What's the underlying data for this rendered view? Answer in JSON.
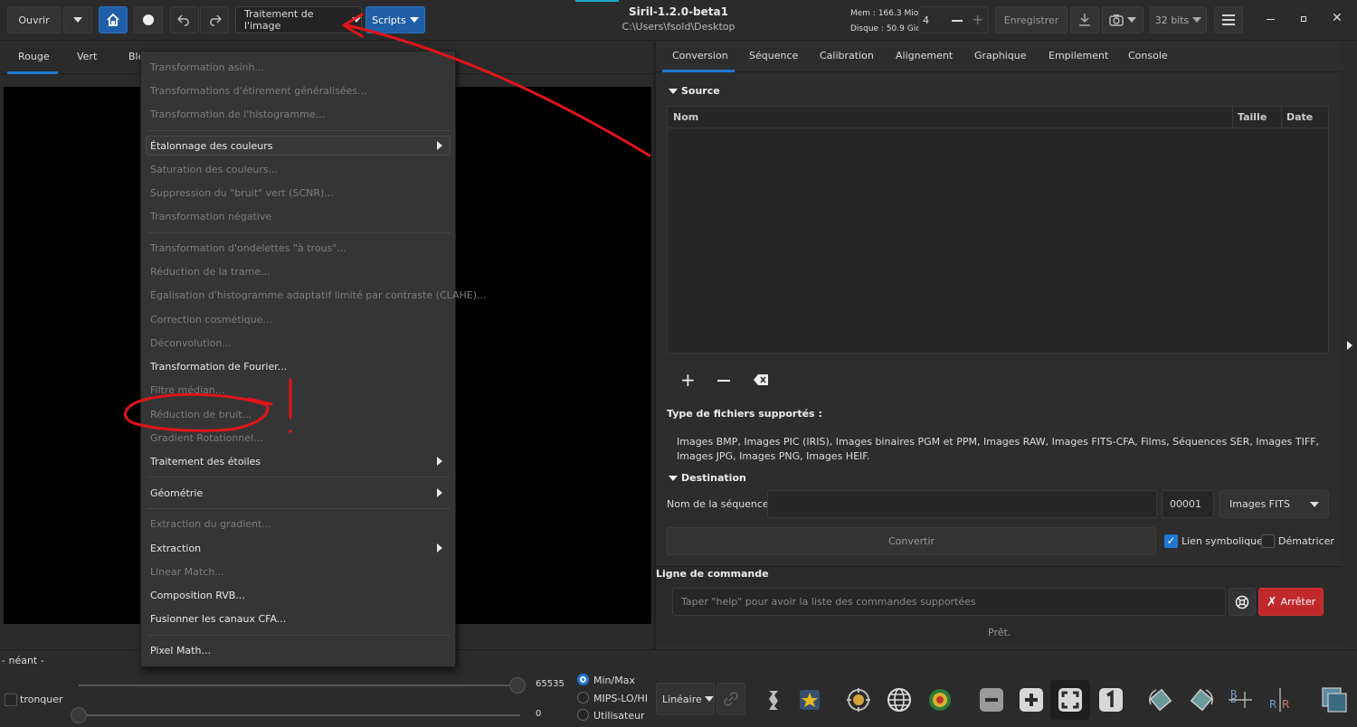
{
  "toolbar": {
    "open_label": "Ouvrir",
    "processing_label": "Traitement de l'image",
    "scripts_label": "Scripts",
    "memory": "Mem : 166.3 Mio",
    "disk": "Disque : 50.9 Gio",
    "threads_value": "4",
    "save_label": "Enregistrer",
    "bitdepth_label": "32 bits"
  },
  "window": {
    "title": "Siril-1.2.0-beta1",
    "path": "C:\\Users\\fsold\\Desktop"
  },
  "left_tabs": [
    "Rouge",
    "Vert",
    "Ble"
  ],
  "right_tabs": [
    "Conversion",
    "Séquence",
    "Calibration",
    "Alignement",
    "Graphique",
    "Empilement",
    "Console"
  ],
  "menu": {
    "items": [
      {
        "label": "Transformation asinh...",
        "enabled": false
      },
      {
        "label": "Transformations d'étirement généralisées...",
        "enabled": false
      },
      {
        "label": "Transformation de l'histogramme...",
        "enabled": false
      },
      {
        "label": "Étalonnage des couleurs",
        "enabled": true
      },
      {
        "label": "Saturation des couleurs...",
        "enabled": false
      },
      {
        "label": "Suppression du \"bruit\" vert (SCNR)...",
        "enabled": false
      },
      {
        "label": "Transformation négative",
        "enabled": false
      },
      {
        "label": "Transformation d'ondelettes \"à trous\"...",
        "enabled": false
      },
      {
        "label": "Réduction de la trame...",
        "enabled": false
      },
      {
        "label": "Égalisation d'histogramme adaptatif limité par contraste (CLAHE)...",
        "enabled": false
      },
      {
        "label": "Correction cosmétique...",
        "enabled": false
      },
      {
        "label": "Déconvolution...",
        "enabled": false
      },
      {
        "label": "Transformation de Fourier...",
        "enabled": true
      },
      {
        "label": "Filtre médian...",
        "enabled": false
      },
      {
        "label": "Réduction de bruit...",
        "enabled": false
      },
      {
        "label": "Gradient Rotationnel...",
        "enabled": false
      },
      {
        "label": "Traitement des étoiles",
        "enabled": true
      },
      {
        "label": "Géométrie",
        "enabled": true
      },
      {
        "label": "Extraction du gradient...",
        "enabled": false
      },
      {
        "label": "Extraction",
        "enabled": true
      },
      {
        "label": "Linear Match...",
        "enabled": false
      },
      {
        "label": "Composition RVB...",
        "enabled": true
      },
      {
        "label": "Fusionner les canaux CFA...",
        "enabled": true
      },
      {
        "label": "Pixel Math...",
        "enabled": true
      }
    ]
  },
  "source": {
    "heading": "Source",
    "col_name": "Nom",
    "col_size": "Taille",
    "col_date": "Date"
  },
  "filetypes": {
    "heading": "Type de fichiers supportés :",
    "text": "Images BMP, Images PIC (IRIS), Images binaires PGM et PPM, Images RAW, Images FITS-CFA, Films, Séquences SER, Images TIFF, Images JPG, Images PNG, Images HEIF."
  },
  "destination": {
    "heading": "Destination",
    "seq_label": "Nom de la séquence :",
    "seq_value": "",
    "index_value": "00001",
    "format_value": "Images FITS",
    "convert_label": "Convertir",
    "symlink_label": "Lien symbolique",
    "symlink_checked": true,
    "debayer_label": "Dématricer",
    "debayer_checked": false
  },
  "command": {
    "heading": "Ligne de commande",
    "placeholder": "Taper \"help\" pour avoir la liste des commandes supportées",
    "stop_label": "Arrêter",
    "status": "Prêt."
  },
  "bottom": {
    "label_none": "- néant -",
    "truncate_label": "tronquer",
    "high_value": "65535",
    "low_value": "0",
    "radio_options": [
      "Min/Max",
      "MIPS-LO/HI",
      "Utilisateur"
    ],
    "radio_selected": "Min/Max",
    "scale_label": "Linéaire"
  },
  "colors": {
    "accent": "#1f5fa8",
    "stop_button": "#c0282c",
    "annotation": "#e0141a"
  }
}
